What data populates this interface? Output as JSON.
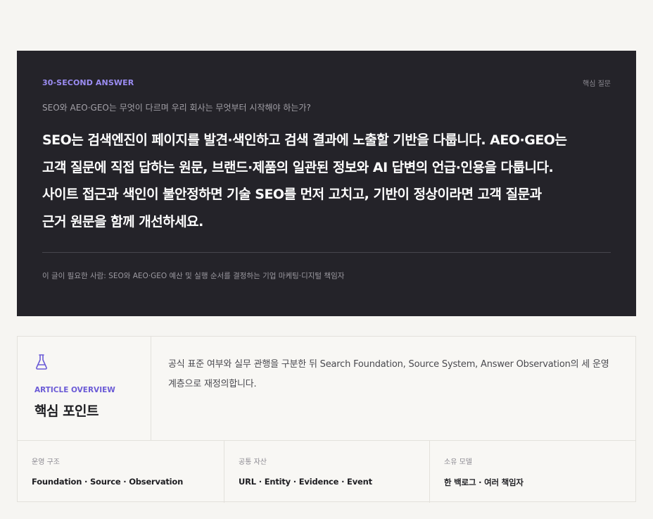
{
  "answer": {
    "eyebrow": "30-SECOND ANSWER",
    "tag": "핵심 질문",
    "question": "SEO와 AEO·GEO는 무엇이 다르며 우리 회사는 무엇부터 시작해야 하는가?",
    "text": "SEO는 검색엔진이 페이지를 발견·색인하고 검색 결과에 노출할 기반을 다룹니다. AEO·GEO는\n고객 질문에 직접 답하는 원문, 브랜드·제품의 일관된 정보와 AI 답변의 언급·인용을 다룹니다.\n사이트 접근과 색인이 불안정하면 기술 SEO를 먼저 고치고, 기반이 정상이라면 고객 질문과\n근거 원문을 함께 개선하세요.",
    "audience": "이 글이 필요한 사람: SEO와 AEO·GEO 예산 및 실행 순서를 결정하는 기업 마케팅·디지털 책임자"
  },
  "overview": {
    "icon": "flask-icon",
    "accent": "#6b5bd6",
    "eyebrow": "ARTICLE OVERVIEW",
    "title": "핵심 포인트",
    "description": "공식 표준 여부와 실무 관행을 구분한 뒤 Search Foundation, Source System, Answer Observation의 세 운영 계층으로 재정의합니다.",
    "cells": [
      {
        "label": "운영 구조",
        "value": "Foundation · Source · Observation"
      },
      {
        "label": "공통 자산",
        "value": "URL · Entity · Evidence · Event"
      },
      {
        "label": "소유 모델",
        "value": "한 백로그 · 여러 책임자"
      }
    ]
  }
}
